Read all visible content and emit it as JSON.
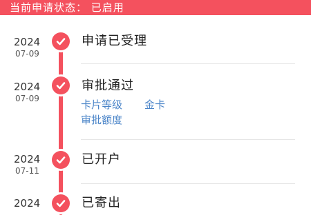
{
  "status_bar": {
    "text": "当前申请状态： 已启用"
  },
  "events": [
    {
      "year": "2024",
      "date": "07-09",
      "title": "申请已受理"
    },
    {
      "year": "2024",
      "date": "07-09",
      "title": "审批通过",
      "details": [
        {
          "label": "卡片等级",
          "value": "金卡"
        },
        {
          "label": "审批额度",
          "value": ""
        }
      ]
    },
    {
      "year": "2024",
      "date": "07-11",
      "title": "已开户"
    },
    {
      "year": "2024",
      "date": "",
      "title": "已寄出"
    }
  ],
  "colors": {
    "accent": "#f4515e",
    "detail_text": "#4a84c8",
    "divider": "#e6e6e6"
  },
  "icons": {
    "node": "check-circle-icon"
  }
}
